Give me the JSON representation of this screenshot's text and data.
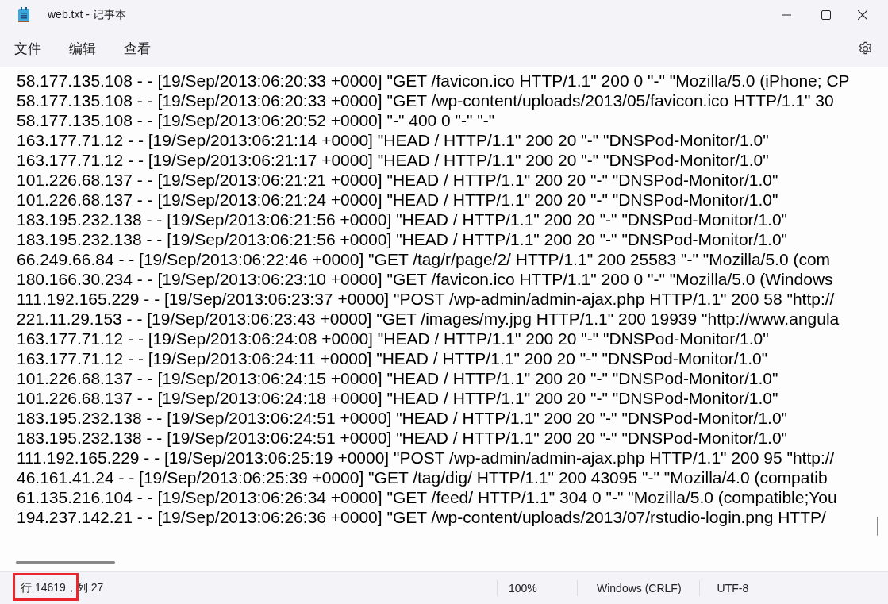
{
  "window": {
    "title": "web.txt - 记事本"
  },
  "menu": [
    {
      "label": "文件"
    },
    {
      "label": "编辑"
    },
    {
      "label": "查看"
    }
  ],
  "lines": [
    "58.177.135.108 - - [19/Sep/2013:06:20:33 +0000] \"GET /favicon.ico HTTP/1.1\" 200 0 \"-\" \"Mozilla/5.0 (iPhone; CP",
    "58.177.135.108 - - [19/Sep/2013:06:20:33 +0000] \"GET /wp-content/uploads/2013/05/favicon.ico HTTP/1.1\" 30",
    "58.177.135.108 - - [19/Sep/2013:06:20:52 +0000] \"-\" 400 0 \"-\" \"-\"",
    "163.177.71.12 - - [19/Sep/2013:06:21:14 +0000] \"HEAD / HTTP/1.1\" 200 20 \"-\" \"DNSPod-Monitor/1.0\"",
    "163.177.71.12 - - [19/Sep/2013:06:21:17 +0000] \"HEAD / HTTP/1.1\" 200 20 \"-\" \"DNSPod-Monitor/1.0\"",
    "101.226.68.137 - - [19/Sep/2013:06:21:21 +0000] \"HEAD / HTTP/1.1\" 200 20 \"-\" \"DNSPod-Monitor/1.0\"",
    "101.226.68.137 - - [19/Sep/2013:06:21:24 +0000] \"HEAD / HTTP/1.1\" 200 20 \"-\" \"DNSPod-Monitor/1.0\"",
    "183.195.232.138 - - [19/Sep/2013:06:21:56 +0000] \"HEAD / HTTP/1.1\" 200 20 \"-\" \"DNSPod-Monitor/1.0\"",
    "183.195.232.138 - - [19/Sep/2013:06:21:56 +0000] \"HEAD / HTTP/1.1\" 200 20 \"-\" \"DNSPod-Monitor/1.0\"",
    "66.249.66.84 - - [19/Sep/2013:06:22:46 +0000] \"GET /tag/r/page/2/ HTTP/1.1\" 200 25583 \"-\" \"Mozilla/5.0 (com",
    "180.166.30.234 - - [19/Sep/2013:06:23:10 +0000] \"GET /favicon.ico HTTP/1.1\" 200 0 \"-\" \"Mozilla/5.0 (Windows",
    "111.192.165.229 - - [19/Sep/2013:06:23:37 +0000] \"POST /wp-admin/admin-ajax.php HTTP/1.1\" 200 58 \"http://",
    "221.11.29.153 - - [19/Sep/2013:06:23:43 +0000] \"GET /images/my.jpg HTTP/1.1\" 200 19939 \"http://www.angula",
    "163.177.71.12 - - [19/Sep/2013:06:24:08 +0000] \"HEAD / HTTP/1.1\" 200 20 \"-\" \"DNSPod-Monitor/1.0\"",
    "163.177.71.12 - - [19/Sep/2013:06:24:11 +0000] \"HEAD / HTTP/1.1\" 200 20 \"-\" \"DNSPod-Monitor/1.0\"",
    "101.226.68.137 - - [19/Sep/2013:06:24:15 +0000] \"HEAD / HTTP/1.1\" 200 20 \"-\" \"DNSPod-Monitor/1.0\"",
    "101.226.68.137 - - [19/Sep/2013:06:24:18 +0000] \"HEAD / HTTP/1.1\" 200 20 \"-\" \"DNSPod-Monitor/1.0\"",
    "183.195.232.138 - - [19/Sep/2013:06:24:51 +0000] \"HEAD / HTTP/1.1\" 200 20 \"-\" \"DNSPod-Monitor/1.0\"",
    "183.195.232.138 - - [19/Sep/2013:06:24:51 +0000] \"HEAD / HTTP/1.1\" 200 20 \"-\" \"DNSPod-Monitor/1.0\"",
    "111.192.165.229 - - [19/Sep/2013:06:25:19 +0000] \"POST /wp-admin/admin-ajax.php HTTP/1.1\" 200 95 \"http://",
    "46.161.41.24 - - [19/Sep/2013:06:25:39 +0000] \"GET /tag/dig/ HTTP/1.1\" 200 43095 \"-\" \"Mozilla/4.0 (compatib",
    "61.135.216.104 - - [19/Sep/2013:06:26:34 +0000] \"GET /feed/ HTTP/1.1\" 304 0 \"-\" \"Mozilla/5.0 (compatible;You",
    "194.237.142.21 - - [19/Sep/2013:06:26:36 +0000] \"GET /wp-content/uploads/2013/07/rstudio-login.png HTTP/"
  ],
  "status_bar": {
    "position": "行 14619，列 27",
    "zoom": "100%",
    "line_ending": "Windows (CRLF)",
    "encoding": "UTF-8"
  }
}
